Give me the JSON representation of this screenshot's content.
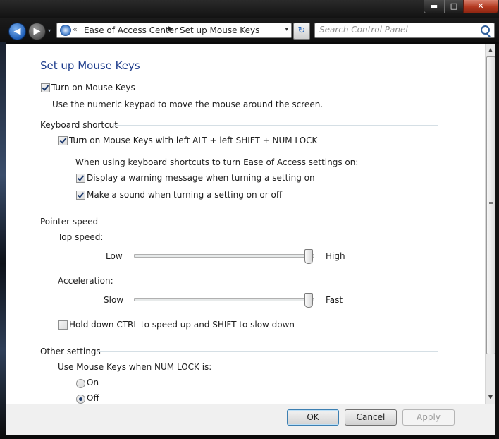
{
  "window": {
    "minimize_label": "▬",
    "maximize_label": "□",
    "close_label": "✕"
  },
  "nav": {
    "back_glyph": "◀",
    "forward_glyph": "▶",
    "dropdown_glyph": "▾"
  },
  "address": {
    "chevron": "«",
    "crumbs": [
      "Ease of Access Center",
      "Set up Mouse Keys"
    ],
    "separator": "▶",
    "dropdown_glyph": "▾"
  },
  "refresh_glyph": "↻",
  "search": {
    "placeholder": "Search Control Panel"
  },
  "page": {
    "title": "Set up Mouse Keys",
    "turn_on": {
      "label": "Turn on Mouse Keys",
      "checked": true
    },
    "turn_on_desc": "Use the numeric keypad to move the mouse around the screen.",
    "keyboard_shortcut": {
      "heading": "Keyboard shortcut",
      "shortcut_option": {
        "label": "Turn on Mouse Keys with left ALT + left SHIFT + NUM LOCK",
        "checked": true
      },
      "intro": "When using keyboard shortcuts to turn Ease of Access settings on:",
      "warning_option": {
        "label": "Display a warning message when turning a setting on",
        "checked": true
      },
      "sound_option": {
        "label": "Make a sound when turning a setting on or off",
        "checked": true
      }
    },
    "pointer_speed": {
      "heading": "Pointer speed",
      "top_speed": {
        "label": "Top speed:",
        "min_label": "Low",
        "max_label": "High",
        "value_fraction": 1.0
      },
      "acceleration": {
        "label": "Acceleration:",
        "min_label": "Slow",
        "max_label": "Fast",
        "value_fraction": 1.0
      },
      "ctrl_shift_option": {
        "label": "Hold down CTRL to speed up and SHIFT to slow down",
        "checked": false
      }
    },
    "other_settings": {
      "heading": "Other settings",
      "numlock_label": "Use Mouse Keys when NUM LOCK is:",
      "options": [
        {
          "label": "On",
          "checked": false
        },
        {
          "label": "Off",
          "checked": true
        }
      ]
    }
  },
  "buttons": {
    "ok": "OK",
    "cancel": "Cancel",
    "apply": "Apply"
  },
  "scrollbar": {
    "up_glyph": "▲",
    "down_glyph": "▼"
  }
}
